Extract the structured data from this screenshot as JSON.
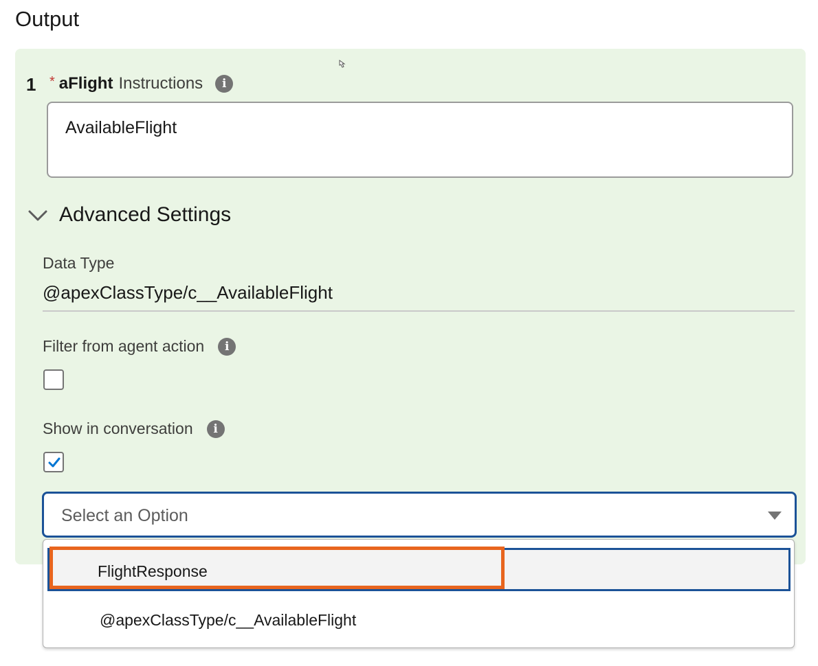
{
  "page_title": "Output",
  "output_item": {
    "number": "1",
    "required_marker": "*",
    "name": "aFlight",
    "label_suffix": "Instructions",
    "instructions_value": "AvailableFlight"
  },
  "advanced_settings": {
    "title": "Advanced Settings",
    "expanded": true,
    "data_type_label": "Data Type",
    "data_type_value": "@apexClassType/c__AvailableFlight",
    "filter_label": "Filter from agent action",
    "filter_checked": false,
    "show_label": "Show in conversation",
    "show_checked": true
  },
  "select": {
    "placeholder": "Select an Option",
    "options": [
      {
        "label": "FlightResponse",
        "highlighted": true
      },
      {
        "label": "@apexClassType/c__AvailableFlight",
        "highlighted": false
      }
    ]
  },
  "icons": {
    "info": "info-icon",
    "chevron": "chevron-down-icon",
    "caret": "caret-down-icon",
    "check": "checkmark-icon",
    "cursor": "hand-cursor-icon"
  },
  "colors": {
    "panel_bg": "#eaf5e5",
    "focus_blue": "#1b5297",
    "highlight_orange": "#e8651e",
    "required_red": "#c23934",
    "check_blue": "#0176d3"
  }
}
